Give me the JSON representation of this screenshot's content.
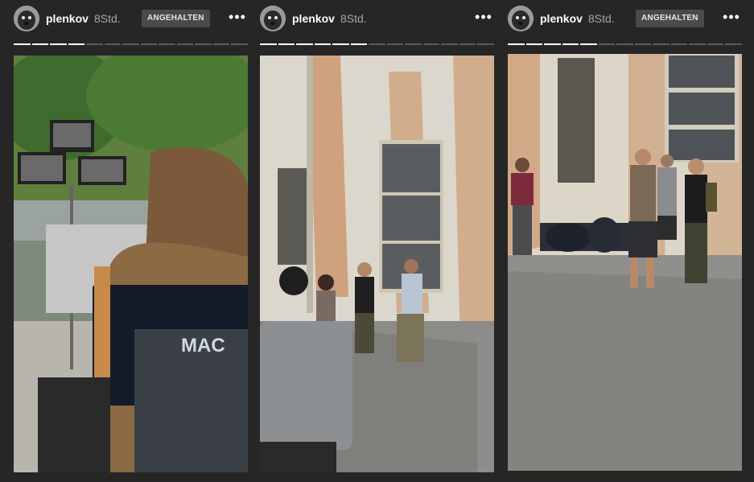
{
  "stories": [
    {
      "username": "plenkov",
      "time": "8Std.",
      "status": "ANGEHALTEN",
      "more": "•••",
      "progress_total": 13,
      "progress_done": 4,
      "chair_text": "MAC"
    },
    {
      "username": "plenkov",
      "time": "8Std.",
      "more": "•••",
      "progress_total": 13,
      "progress_done": 6
    },
    {
      "username": "plenkov",
      "time": "8Std.",
      "status": "ANGEHALTEN",
      "more": "•••",
      "progress_total": 13,
      "progress_done": 5
    }
  ],
  "colors": {
    "background": "#262626",
    "progress_done": "#ffffff",
    "progress_pending": "#5a5a5a",
    "badge": "#4a4a4a"
  },
  "icons": [
    "avatar",
    "more-options-icon"
  ]
}
